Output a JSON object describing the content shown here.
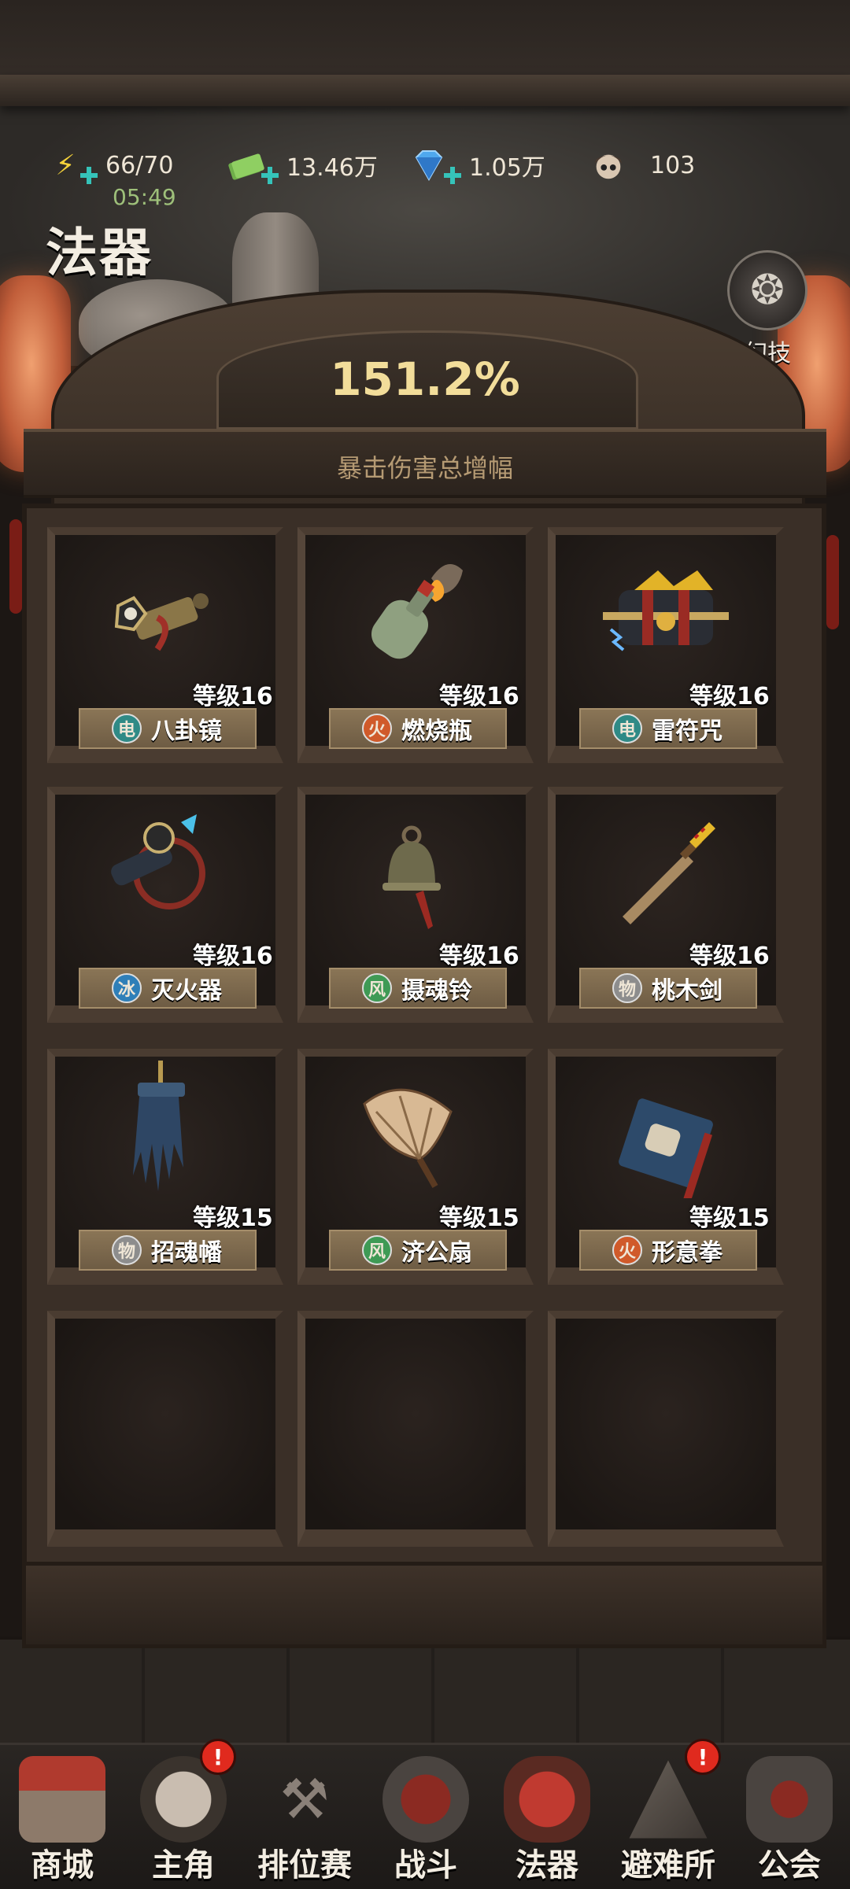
{
  "status": {
    "energy": "66/70",
    "energy_timer": "05:49",
    "cash": "13.46万",
    "gems": "1.05万",
    "avatar_count": "103"
  },
  "page_title": "法器",
  "skill_button": {
    "label": "幻技",
    "icon": "swirl-rune-icon"
  },
  "header": {
    "crit_value": "151.2%",
    "crit_label": "暴击伤害总增幅"
  },
  "items": [
    {
      "name": "八卦镜",
      "level": "等级16",
      "element": "电",
      "element_color": "#2f8a86",
      "icon": "bagua-mirror-icon"
    },
    {
      "name": "燃烧瓶",
      "level": "等级16",
      "element": "火",
      "element_color": "#d05a2a",
      "icon": "molotov-bottle-icon"
    },
    {
      "name": "雷符咒",
      "level": "等级16",
      "element": "电",
      "element_color": "#2f8a86",
      "icon": "thunder-talisman-icon"
    },
    {
      "name": "灭火器",
      "level": "等级16",
      "element": "冰",
      "element_color": "#2f7fb8",
      "icon": "extinguisher-icon"
    },
    {
      "name": "摄魂铃",
      "level": "等级16",
      "element": "风",
      "element_color": "#3f9a55",
      "icon": "soul-bell-icon"
    },
    {
      "name": "桃木剑",
      "level": "等级16",
      "element": "物",
      "element_color": "#8d8d8d",
      "icon": "peach-wood-sword-icon"
    },
    {
      "name": "招魂幡",
      "level": "等级15",
      "element": "物",
      "element_color": "#8d8d8d",
      "icon": "soul-banner-icon"
    },
    {
      "name": "济公扇",
      "level": "等级15",
      "element": "风",
      "element_color": "#3f9a55",
      "icon": "jigong-fan-icon"
    },
    {
      "name": "形意拳",
      "level": "等级15",
      "element": "火",
      "element_color": "#d05a2a",
      "icon": "xingyi-fist-book-icon"
    }
  ],
  "nav": [
    {
      "label": "商城",
      "icon": "shop-stall-icon",
      "badge": ""
    },
    {
      "label": "主角",
      "icon": "hero-face-icon",
      "badge": "!"
    },
    {
      "label": "排位赛",
      "icon": "rifle-shovel-icon",
      "badge": ""
    },
    {
      "label": "战斗",
      "icon": "battle-saw-icon",
      "badge": ""
    },
    {
      "label": "法器",
      "icon": "artifact-lantern-icon",
      "badge": ""
    },
    {
      "label": "避难所",
      "icon": "shelter-tent-icon",
      "badge": "!"
    },
    {
      "label": "公会",
      "icon": "guild-helmet-icon",
      "badge": ""
    }
  ]
}
